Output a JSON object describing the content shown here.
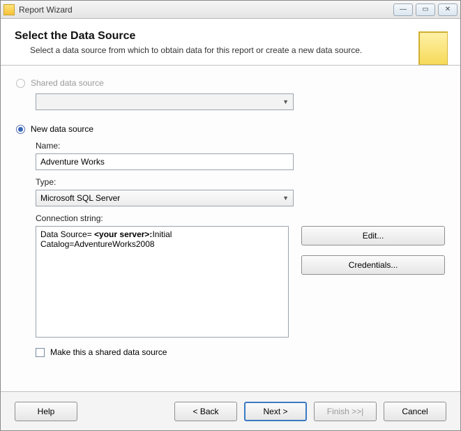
{
  "window": {
    "title": "Report Wizard"
  },
  "header": {
    "title": "Select the Data Source",
    "subtitle": "Select a data source from which to obtain data for this report or create a new data source."
  },
  "options": {
    "shared_label": "Shared data source",
    "shared_selected": "",
    "new_label": "New data source"
  },
  "fields": {
    "name_label": "Name:",
    "name_value": "Adventure Works",
    "type_label": "Type:",
    "type_value": "Microsoft SQL Server",
    "conn_label": "Connection string:",
    "conn_prefix": "Data Source= ",
    "conn_bold": "<your server>:",
    "conn_suffix": "Initial Catalog=AdventureWorks2008",
    "make_shared_label": "Make this a shared data source"
  },
  "side_buttons": {
    "edit": "Edit...",
    "credentials": "Credentials..."
  },
  "footer": {
    "help": "Help",
    "back": "< Back",
    "next": "Next >",
    "finish": "Finish >>|",
    "cancel": "Cancel"
  }
}
